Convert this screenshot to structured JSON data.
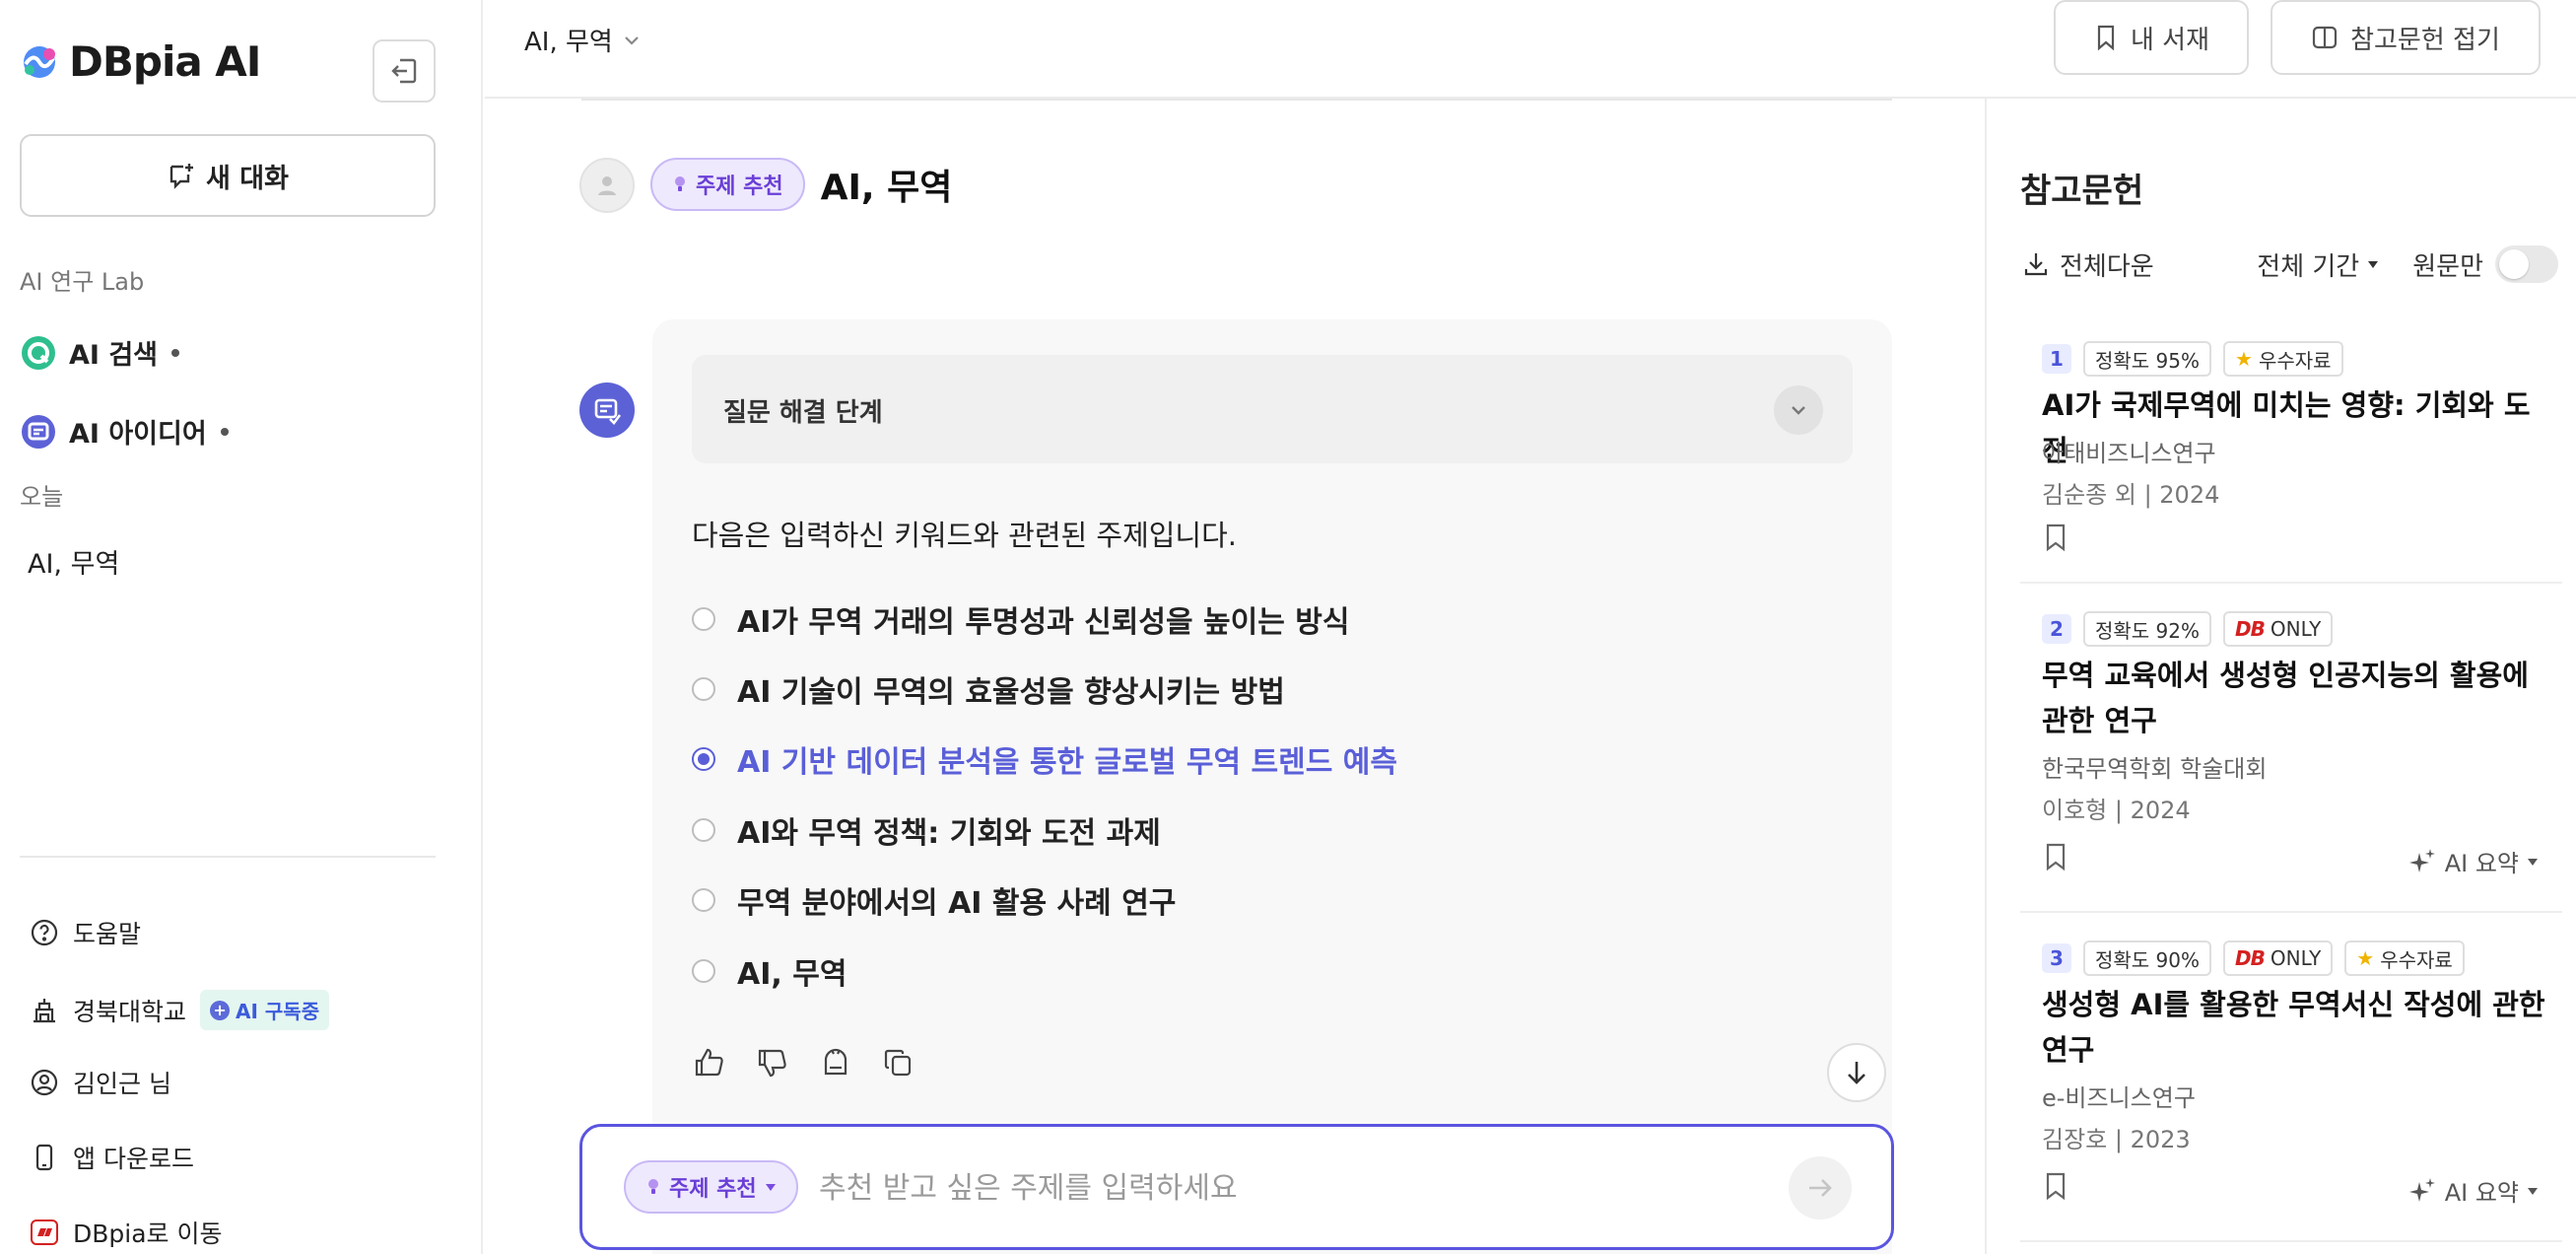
{
  "sidebar": {
    "logo": "DBpia AI",
    "new_chat": "새 대화",
    "lab_label": "AI 연구 Lab",
    "lab_items": [
      {
        "label": "AI 검색",
        "icon": "ai-search-icon"
      },
      {
        "label": "AI 아이디어",
        "icon": "ai-idea-icon"
      }
    ],
    "today_label": "오늘",
    "history": [
      {
        "label": "AI, 무역"
      }
    ],
    "footer": {
      "help": "도움말",
      "school": "경북대학교",
      "subscription_badge": "AI 구독중",
      "user": "김인근 님",
      "app_download": "앱 다운로드",
      "go_dbpia": "DBpia로 이동"
    }
  },
  "topbar": {
    "breadcrumb": "AI, 무역",
    "my_library": "내 서재",
    "collapse_refs": "참고문헌 접기"
  },
  "chat": {
    "mode_pill": "주제 추천",
    "user_query": "AI, 무역",
    "steps_label": "질문 해결 단계",
    "intro": "다음은 입력하신 키워드와 관련된 주제입니다.",
    "topics": [
      {
        "label": "AI가 무역 거래의 투명성과 신뢰성을 높이는 방식",
        "selected": false
      },
      {
        "label": "AI 기술이 무역의 효율성을 향상시키는 방법",
        "selected": false
      },
      {
        "label": "AI 기반 데이터 분석을 통한 글로벌 무역 트렌드 예측",
        "selected": true
      },
      {
        "label": "AI와 무역 정책: 기회와 도전 과제",
        "selected": false
      },
      {
        "label": "무역 분야에서의 AI 활용 사례 연구",
        "selected": false
      },
      {
        "label": "AI, 무역",
        "selected": false
      }
    ]
  },
  "composer": {
    "mode_pill": "주제 추천",
    "placeholder": "추천 받고 싶은 주제를 입력하세요"
  },
  "refs": {
    "title": "참고문헌",
    "download_all": "전체다운",
    "period": "전체 기간",
    "original_only": "원문만",
    "ai_summary": "AI 요약",
    "items": [
      {
        "num": "1",
        "accuracy": "정확도 95%",
        "tags": [
          "우수자료"
        ],
        "title": "AI가 국제무역에 미치는 영향: 기회와 도전",
        "journal": "아태비즈니스연구",
        "author_year": "김순종 외 | 2024"
      },
      {
        "num": "2",
        "accuracy": "정확도 92%",
        "db_tag": "DB",
        "only_tag": "ONLY",
        "title": "무역 교육에서 생성형 인공지능의 활용에 관한 연구",
        "journal": "한국무역학회 학술대회",
        "author_year": "이호형 | 2024"
      },
      {
        "num": "3",
        "accuracy": "정확도 90%",
        "db_tag": "DB",
        "only_tag": "ONLY",
        "tags": [
          "우수자료"
        ],
        "title": "생성형 AI를 활용한 무역서신 작성에 관한 연구",
        "journal": "e-비즈니스연구",
        "author_year": "김장호 | 2023"
      }
    ]
  },
  "colors": {
    "accent": "#5a5fd8",
    "pill_bg": "#eee9fd",
    "pill_text": "#6a3fd6",
    "db_red": "#d42020"
  }
}
